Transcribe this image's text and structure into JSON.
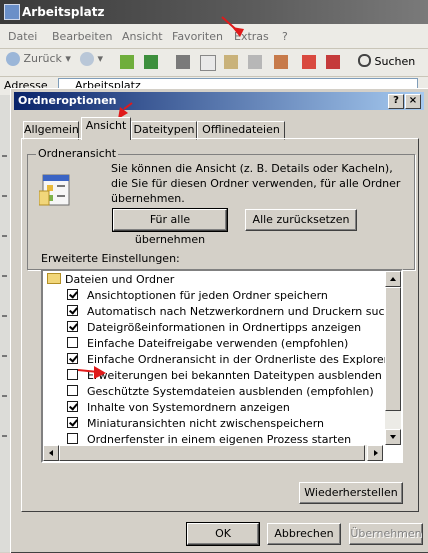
{
  "window": {
    "title": "Arbeitsplatz",
    "menu": [
      "Datei",
      "Bearbeiten",
      "Ansicht",
      "Favoriten",
      "Extras",
      "?"
    ],
    "toolbar": {
      "back_label": "Zurück",
      "search_label": "Suchen"
    },
    "address_label": "Adresse",
    "address_value": "Arbeitsplatz"
  },
  "dialog": {
    "title": "Ordneroptionen",
    "help_label": "?",
    "close_label": "×",
    "tabs": [
      "Allgemein",
      "Ansicht",
      "Dateitypen",
      "Offlinedateien"
    ],
    "selected_tab": "Ansicht",
    "folder_view": {
      "legend": "Ordneransicht",
      "description": "Sie können die Ansicht (z. B. Details oder Kacheln), die Sie für diesen Ordner verwenden, für alle Ordner übernehmen.",
      "apply_all_label": "Für alle übernehmen",
      "reset_all_label": "Alle zurücksetzen"
    },
    "advanced": {
      "label": "Erweiterte Einstellungen:",
      "root": "Dateien und Ordner",
      "items": [
        {
          "label": "Ansichtoptionen für jeden Ordner speichern",
          "checked": true
        },
        {
          "label": "Automatisch nach Netzwerkordnern und Druckern suchen",
          "checked": true
        },
        {
          "label": "Dateigrößeinformationen in Ordnertipps anzeigen",
          "checked": true
        },
        {
          "label": "Einfache Dateifreigabe verwenden (empfohlen)",
          "checked": false
        },
        {
          "label": "Einfache Ordneransicht in der Ordnerliste des Explorers anzeige",
          "checked": true
        },
        {
          "label": "Erweiterungen bei bekannten Dateitypen ausblenden",
          "checked": false
        },
        {
          "label": "Geschützte Systemdateien ausblenden (empfohlen)",
          "checked": false
        },
        {
          "label": "Inhalte von Systemordnern anzeigen",
          "checked": true
        },
        {
          "label": "Miniaturansichten nicht zwischenspeichern",
          "checked": true
        },
        {
          "label": "Ordnerfenster in einem eigenen Prozess starten",
          "checked": false
        }
      ]
    },
    "restore_label": "Wiederherstellen",
    "ok_label": "OK",
    "cancel_label": "Abbrechen",
    "apply_label": "Übernehmen"
  },
  "colors": {
    "dialog_title": "#0a246a",
    "annotation_arrow": "#e01a1a",
    "face": "#d4d0c8"
  }
}
